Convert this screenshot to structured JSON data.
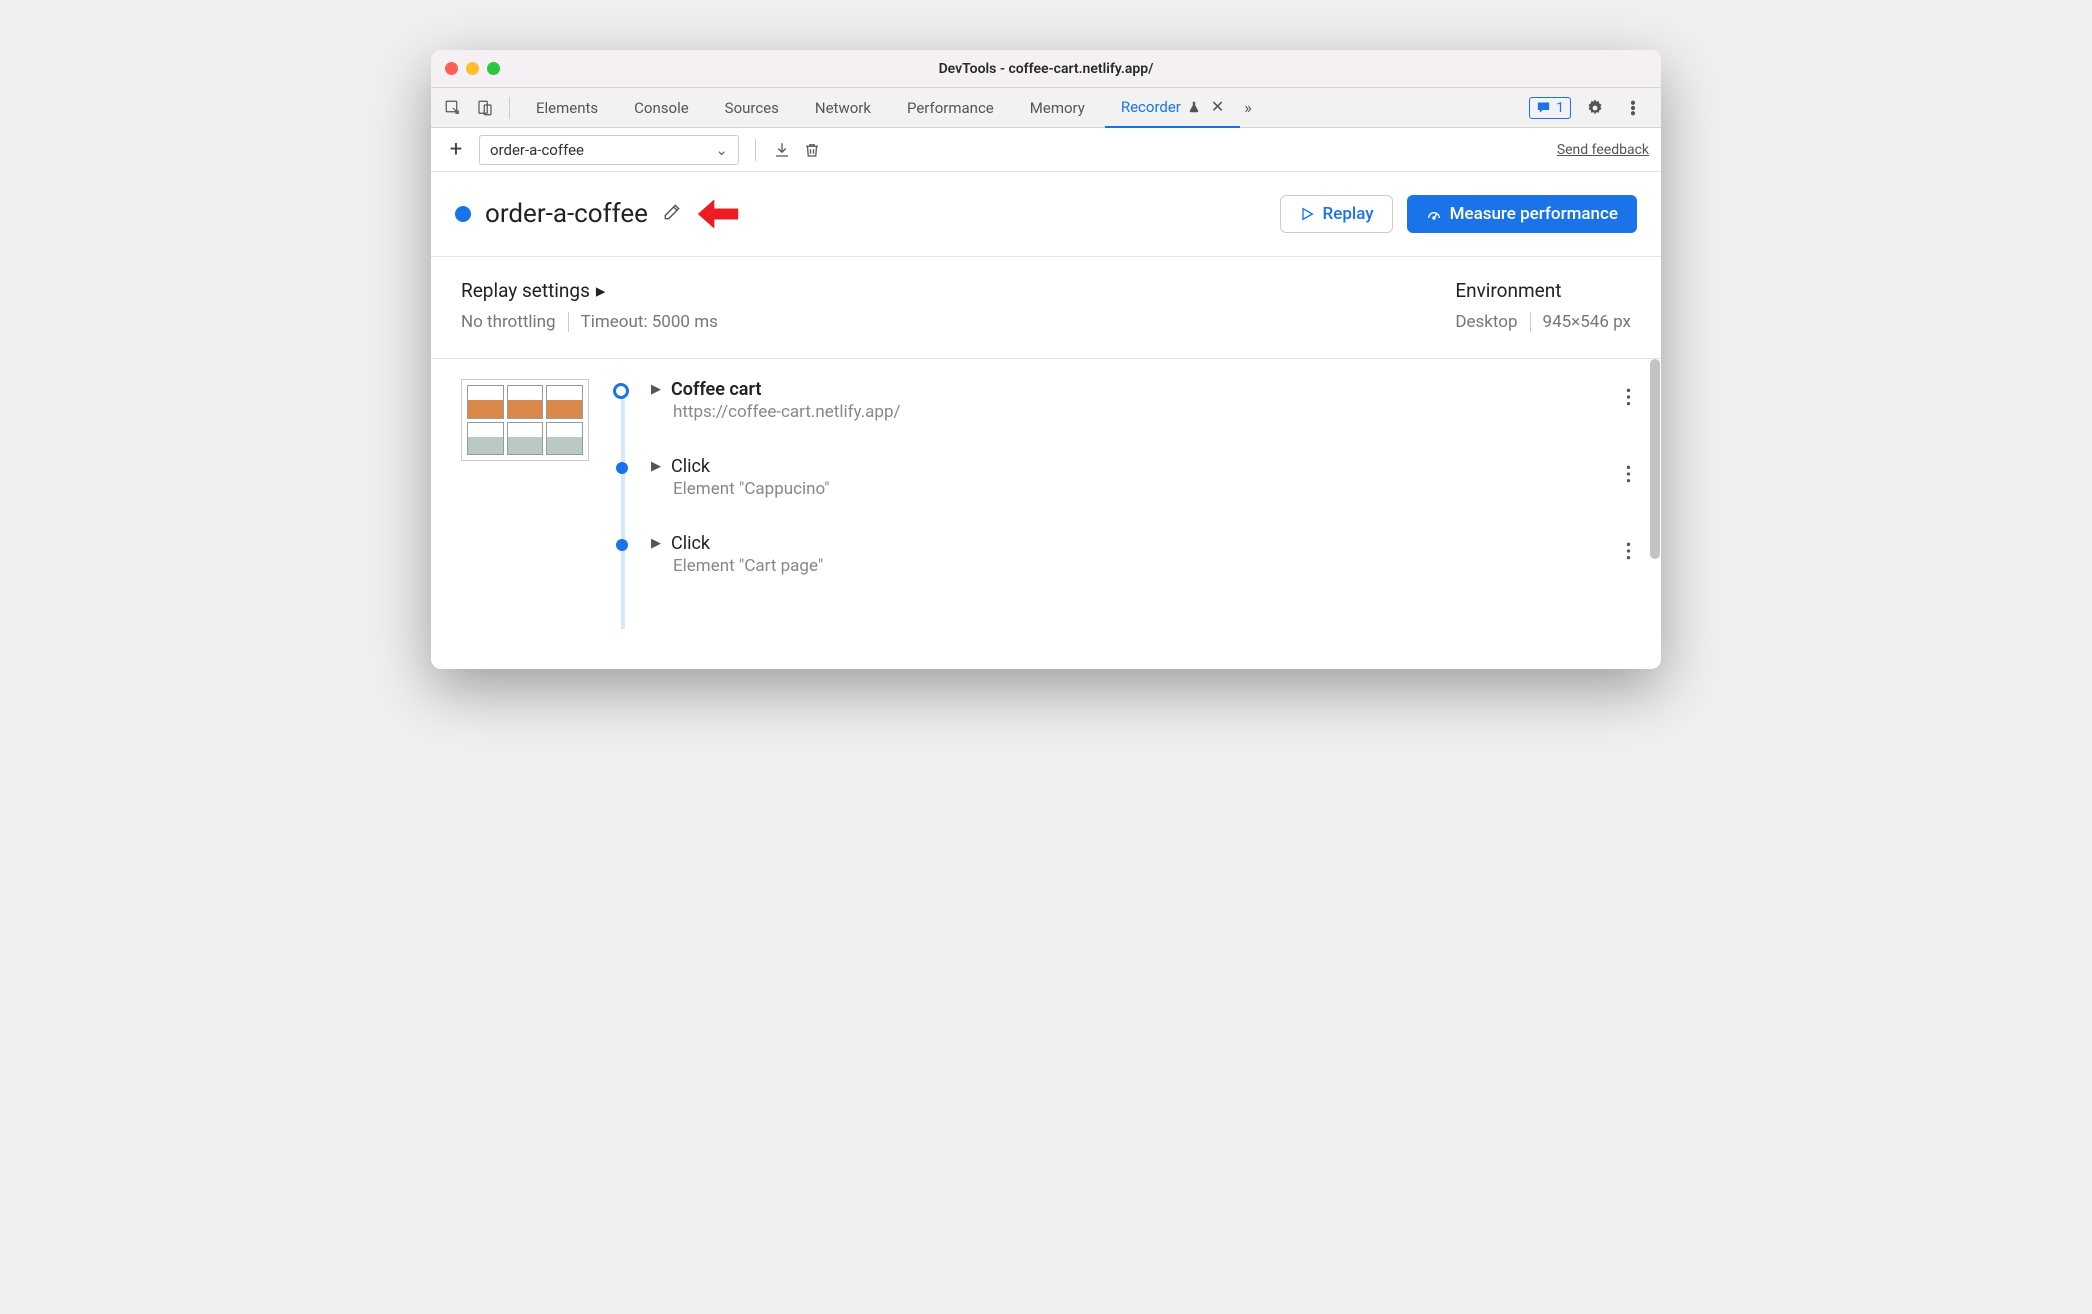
{
  "window": {
    "title": "DevTools - coffee-cart.netlify.app/"
  },
  "tabs": {
    "items": [
      "Elements",
      "Console",
      "Sources",
      "Network",
      "Performance",
      "Memory"
    ],
    "active": "Recorder",
    "overflow": "»"
  },
  "topRight": {
    "msgCount": "1"
  },
  "toolbar": {
    "plus": "+",
    "recordingName": "order-a-coffee",
    "sendFeedback": "Send feedback"
  },
  "header": {
    "title": "order-a-coffee",
    "replay": "Replay",
    "measure": "Measure performance"
  },
  "settings": {
    "replayTitle": "Replay settings",
    "throttling": "No throttling",
    "timeout": "Timeout: 5000 ms",
    "envTitle": "Environment",
    "device": "Desktop",
    "viewport": "945×546 px"
  },
  "steps": [
    {
      "title": "Coffee cart",
      "sub": "https://coffee-cart.netlify.app/",
      "bold": true,
      "first": true
    },
    {
      "title": "Click",
      "sub": "Element \"Cappucino\"",
      "bold": false,
      "first": false
    },
    {
      "title": "Click",
      "sub": "Element \"Cart page\"",
      "bold": false,
      "first": false
    }
  ]
}
